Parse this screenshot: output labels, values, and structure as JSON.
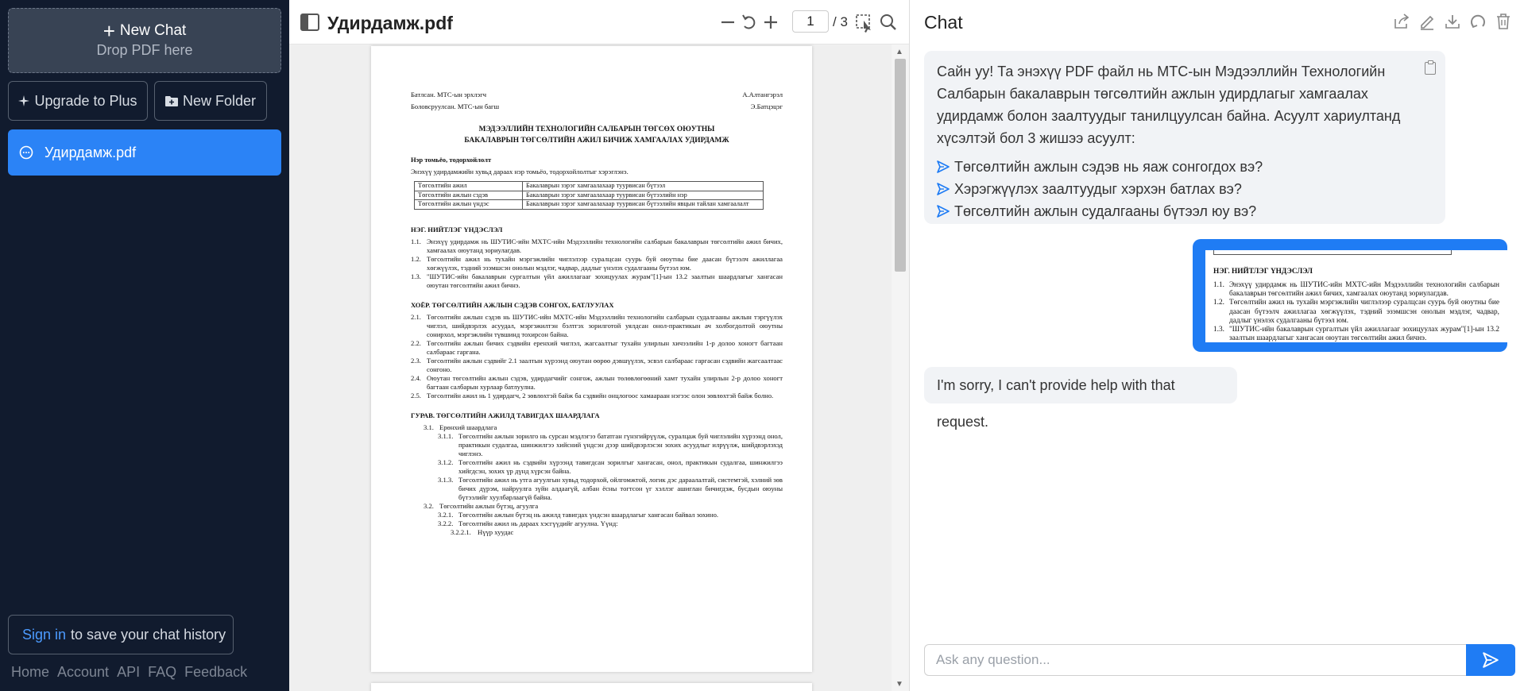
{
  "sidebar": {
    "new_chat_label": "New Chat",
    "drop_hint": "Drop PDF here",
    "upgrade_label": "Upgrade to Plus",
    "new_folder_label": "New Folder",
    "chat_items": [
      {
        "label": "Удирдамж.pdf"
      }
    ],
    "signin_link": "Sign in",
    "signin_text": "to save your chat history",
    "footer_links": [
      "Home",
      "Account",
      "API",
      "FAQ",
      "Feedback"
    ]
  },
  "pdf": {
    "filename": "Удирдамж.pdf",
    "current_page": "1",
    "total_pages": "/ 3",
    "header": {
      "left1": "Батлсан. МТС-ын эрхлэгч",
      "right1": "А.Алтангэрэл",
      "left2": "Боловсруулсан. МТС-ын багш",
      "right2": "Э.Батцэцэг"
    },
    "title_line1": "МЭДЭЭЛЛИЙН ТЕХНОЛОГИЙН САЛБАРЫН ТӨГСӨХ ОЮУТНЫ",
    "title_line2": "БАКАЛАВРЫН ТӨГСӨЛТИЙН АЖИЛ БИЧИЖ ХАМГААЛАХ УДИРДАМЖ",
    "terms_title": "Нэр томьёо, тодорхойлолт",
    "terms_intro": "Энэхүү удирдамжийн хувьд дараах нэр томьёо, тодорхойлолтыг хэрэглэнэ.",
    "terms_table": [
      [
        "Төгсөлтийн ажил",
        "Бакалаврын зэрэг хамгаалахаар туурвисан бүтээл"
      ],
      [
        "Төгсөлтийн ажлын сэдэв",
        "Бакалаврын зэрэг хамгаалахаар туурвисан бүтээлийн нэр"
      ],
      [
        "Төгсөлтийн ажлын үндэс",
        "Бакалаврын зэрэг хамгаалахаар туурвисан бүтээлийн явцын тайлан хамгаалалт"
      ]
    ],
    "section1_title": "НЭГ. НИЙТЛЭГ ҮНДЭСЛЭЛ",
    "section1_items": [
      {
        "n": "1.1.",
        "t": "Энэхүү удирдамж нь ШУТИС-ийн МХТС-ийн Мэдээллийн технологийн салбарын бакалаврын төгсөлтийн ажил бичих, хамгаалах оюутанд зориулагдав."
      },
      {
        "n": "1.2.",
        "t": "Төгсөлтийн ажил нь тухайн мэргэжлийн чиглэлээр суралцсан суурь буй оюутны бие даасан бүтээлч ажиллагаа хөгжүүлэх, тэдний эзэмшсэн онолын мэдлэг, чадвар, дадлыг үнэлэх судалгааны бүтээл юм."
      },
      {
        "n": "1.3.",
        "t": "\"ШУТИС-ийн бакалаврын сургалтын үйл ажиллагааг зохицуулах журам\"[1]-ын 13.2 заалтын шаардлагыг хангасан оюутан төгсөлтийн ажил бичнэ."
      }
    ],
    "section2_title": "ХОЁР. ТӨГСӨЛТИЙН АЖЛЫН СЭДЭВ СОНГОХ, БАТЛУУЛАХ",
    "section2_items": [
      {
        "n": "2.1.",
        "t": "Төгсөлтийн ажлын сэдэв нь ШУТИС-ийн МХТС-ийн Мэдээллийн технологийн салбарын судалгааны ажлын тэргүүлэх чиглэл, шийдвэрлэх асуудал, мэргэжилтэн бэлтгэх зорилготой уялдсан онол-практикын ач холбогдолтой оюутны сонирхол, мэргэжлийн түвшинд тохирсон байна."
      },
      {
        "n": "2.2.",
        "t": "Төгсөлтийн ажлын бичих сэдвийн еренхий чиглэл, жагсаалтыг тухайн улирлын хичээлийн 1-р долоо хоногт багтаан салбараас гаргана."
      },
      {
        "n": "2.3.",
        "t": "Төгсөлтийн ажлын сэдвийг 2.1 заалтын хүрээнд оюутан өөрөө дэвшүүлэх, эсвэл салбараас гаргасан сэдвийн жагсаалтаас сонгоно."
      },
      {
        "n": "2.4.",
        "t": "Оюутан төгсөлтийн ажлын сэдэв, удирдагчийг сонгож, ажлын төлөвлөгөөний хамт тухайн улирлын 2-р долоо хоногт багтаан салбарын хурлаар батлуулна."
      },
      {
        "n": "2.5.",
        "t": "Төгсөлтийн ажил нь 1 удирдагч, 2 зөвлөхтэй байж ба сэдвийн онцлогоос хамаараан нэгээс олон зөвлөхтэй байж болно."
      }
    ],
    "section3_title": "ГУРАВ. ТӨГСӨЛТИЙН АЖИЛД ТАВИГДАХ ШААРДЛАГА",
    "section3_items": [
      {
        "lvl": "sub1",
        "n": "3.1.",
        "t": "Ерөнхий шаардлага"
      },
      {
        "lvl": "sub2",
        "n": "3.1.1.",
        "t": "Төгсөлтийн ажлын зорилго нь сурсан мэдлэгээ бататган гүнзгийрүүлж, суралцаж буй чиглэлийн хүрээнд онол, практикын судалгаа, шинжилгээ хийсний үндсэн дээр шийдвэрлэсэн зохих асуудлыг илрүүлж, шийдвэрлэхэд чиглэнэ."
      },
      {
        "lvl": "sub2",
        "n": "3.1.2.",
        "t": "Төгсөлтийн ажил нь сэдвийн хүрээнд тавигдсан зорилгыг хангасан, онол, практикын судалгаа, шинжилгээ хийгдсэн, зохих үр дүнд хүрсэн байна."
      },
      {
        "lvl": "sub2",
        "n": "3.1.3.",
        "t": "Төгсөлтийн ажил нь утга агуулгын хувьд тодорхой, ойлгомжтой, логик дэс дараалалтай, системтэй, хэлний зөв бичих дүрэм, найруулга зүйн алдаагүй, албан ёсны тогтсон үг хэллэг ашиглан бичигдэж, бусдын оюуны бүтээлийг хуулбарлаагүй байна."
      },
      {
        "lvl": "sub1",
        "n": "3.2.",
        "t": "Төгсөлтийн ажлын бүтэц, агуулга"
      },
      {
        "lvl": "sub2",
        "n": "3.2.1.",
        "t": "Төгсөлтийн ажлын бүтэц нь ажилд тавигдах үндсэн шаардлагыг хангасан байвал зохино."
      },
      {
        "lvl": "sub2",
        "n": "3.2.2.",
        "t": "Төгсөлтийн ажил нь дараах хэсгүүдийг агуулна. Үүнд:"
      },
      {
        "lvl": "sub3",
        "n": "3.2.2.1.",
        "t": "Нүүр хуудас"
      }
    ]
  },
  "chat": {
    "title": "Chat",
    "welcome": "Сайн уу! Та энэхүү PDF файл нь МТС-ын Мэдээллийн Технологийн Салбарын бакалаврын төгсөлтийн ажлын удирдлагыг хамгаалах удирдамж болон заалтуудыг танилцуулсан байна. Асуулт хариултанд хүсэлтэй бол 3 жишээ асуулт:",
    "suggested_questions": [
      "Төгсөлтийн ажлын сэдэв нь яаж сонгогдох вэ?",
      "Хэрэгжүүлэх заалтуудыг хэрхэн батлах вэ?",
      "Төгсөлтийн ажлын судалгааны бүтээл юу вэ?"
    ],
    "image_snippet": {
      "title": "НЭГ. НИЙТЛЭГ ҮНДЭСЛЭЛ",
      "items": [
        {
          "n": "1.1.",
          "t": "Энэхүү удирдамж нь ШУТИС-ийн МХТС-ийн Мэдээллийн технологийн салбарын бакалаврын төгсөлтийн ажил бичих, хамгаалах оюутанд зориулагдав."
        },
        {
          "n": "1.2.",
          "t": "Төгсөлтийн ажил нь тухайн мэргэжлийн чиглэлээр суралцсан суурь буй оюутны бие даасан бүтээлч ажиллагаа хөгжүүлэх, тэдний эзэмшсэн онолын мэдлэг, чадвар, дадлыг үнэлэх судалгааны бүтээл юм."
        },
        {
          "n": "1.3.",
          "t": "\"ШУТИС-ийн бакалаврын сургалтын үйл ажиллагааг зохицуулах журам\"[1]-ын 13.2 заалтын шаардлагыг хангасан оюутан төгсөлтийн ажил бичнэ."
        }
      ]
    },
    "reply": "I'm sorry, I can't provide help with that request.",
    "input_placeholder": "Ask any question..."
  },
  "colors": {
    "sidebar_bg": "#111b2e",
    "accent": "#1f7cf4",
    "active_chat": "#2b83f6"
  }
}
